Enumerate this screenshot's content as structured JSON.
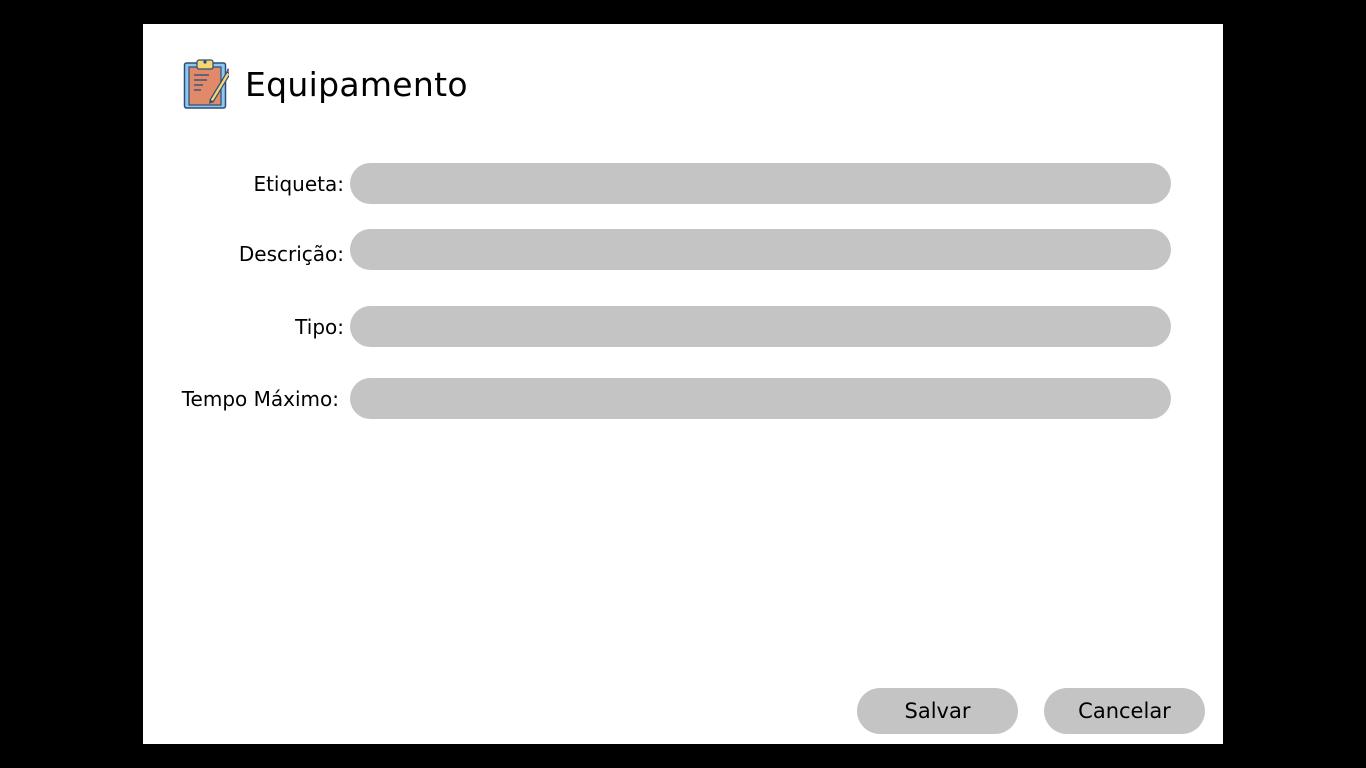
{
  "dialog": {
    "title": "Equipamento",
    "icon": "clipboard-edit-icon"
  },
  "form": {
    "fields": [
      {
        "label": "Etiqueta:",
        "value": "",
        "placeholder": ""
      },
      {
        "label": "Descrição:",
        "value": "",
        "placeholder": ""
      },
      {
        "label": "Tipo:",
        "value": "",
        "placeholder": ""
      },
      {
        "label": "Tempo Máximo:",
        "value": "",
        "placeholder": ""
      }
    ]
  },
  "actions": {
    "save_label": "Salvar",
    "cancel_label": "Cancelar"
  },
  "colors": {
    "background": "#000000",
    "dialog": "#ffffff",
    "input_fill": "#c4c4c4",
    "icon_board": "#e08a6a",
    "icon_clip": "#f5d76e",
    "icon_border": "#4a90c8"
  }
}
